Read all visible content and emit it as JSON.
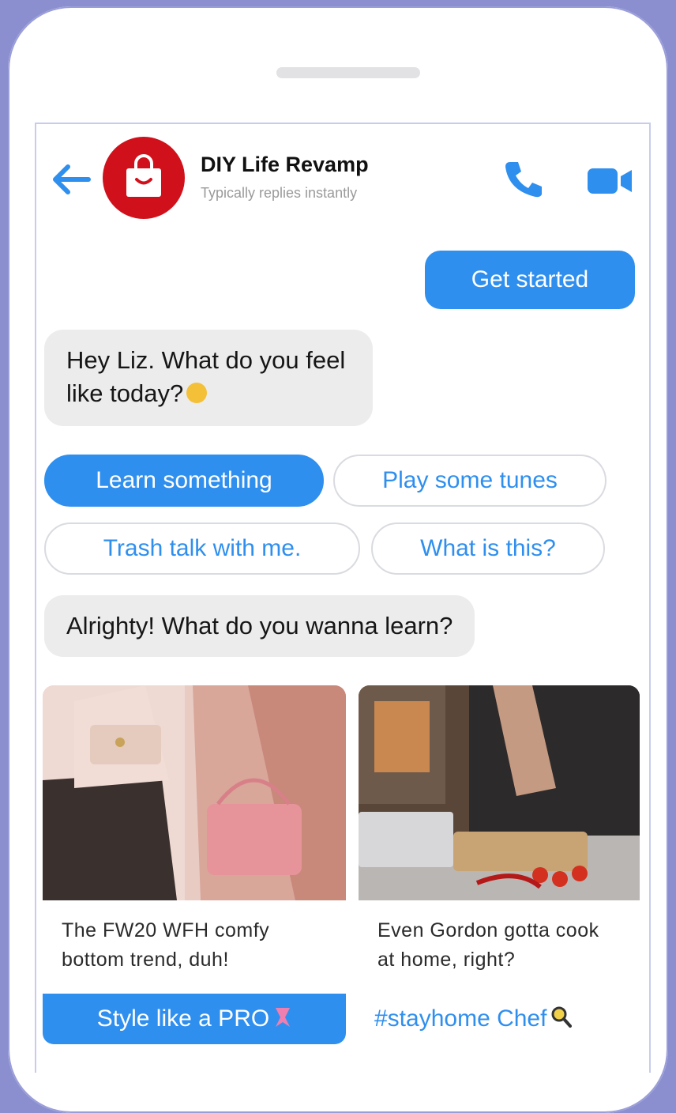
{
  "header": {
    "title": "DIY Life Revamp",
    "subtitle": "Typically replies instantly"
  },
  "messages": {
    "user_get_started": "Get started",
    "bot_greeting": "Hey Liz. What do you feel like today?",
    "bot_learn": "Alrighty! What do you wanna learn?"
  },
  "quick_replies": [
    {
      "label": "Learn something",
      "selected": true
    },
    {
      "label": "Play some tunes",
      "selected": false
    },
    {
      "label": "Trash talk with me.",
      "selected": false
    },
    {
      "label": "What is this?",
      "selected": false
    }
  ],
  "cards": [
    {
      "text": "The FW20 WFH comfy bottom trend, duh!",
      "button": "Style like a PRO"
    },
    {
      "text": "Even Gordon gotta cook at home, right?",
      "button": "#stayhome Chef"
    }
  ],
  "colors": {
    "background": "#8b8fd0",
    "accent": "#2f8fee",
    "avatar": "#d0111b",
    "bot_bubble": "#ececec"
  },
  "icons": [
    "back-arrow-icon",
    "shopping-bag-icon",
    "phone-icon",
    "video-camera-icon",
    "thinking-face-emoji-icon",
    "ribbon-icon",
    "magnifier-icon"
  ]
}
